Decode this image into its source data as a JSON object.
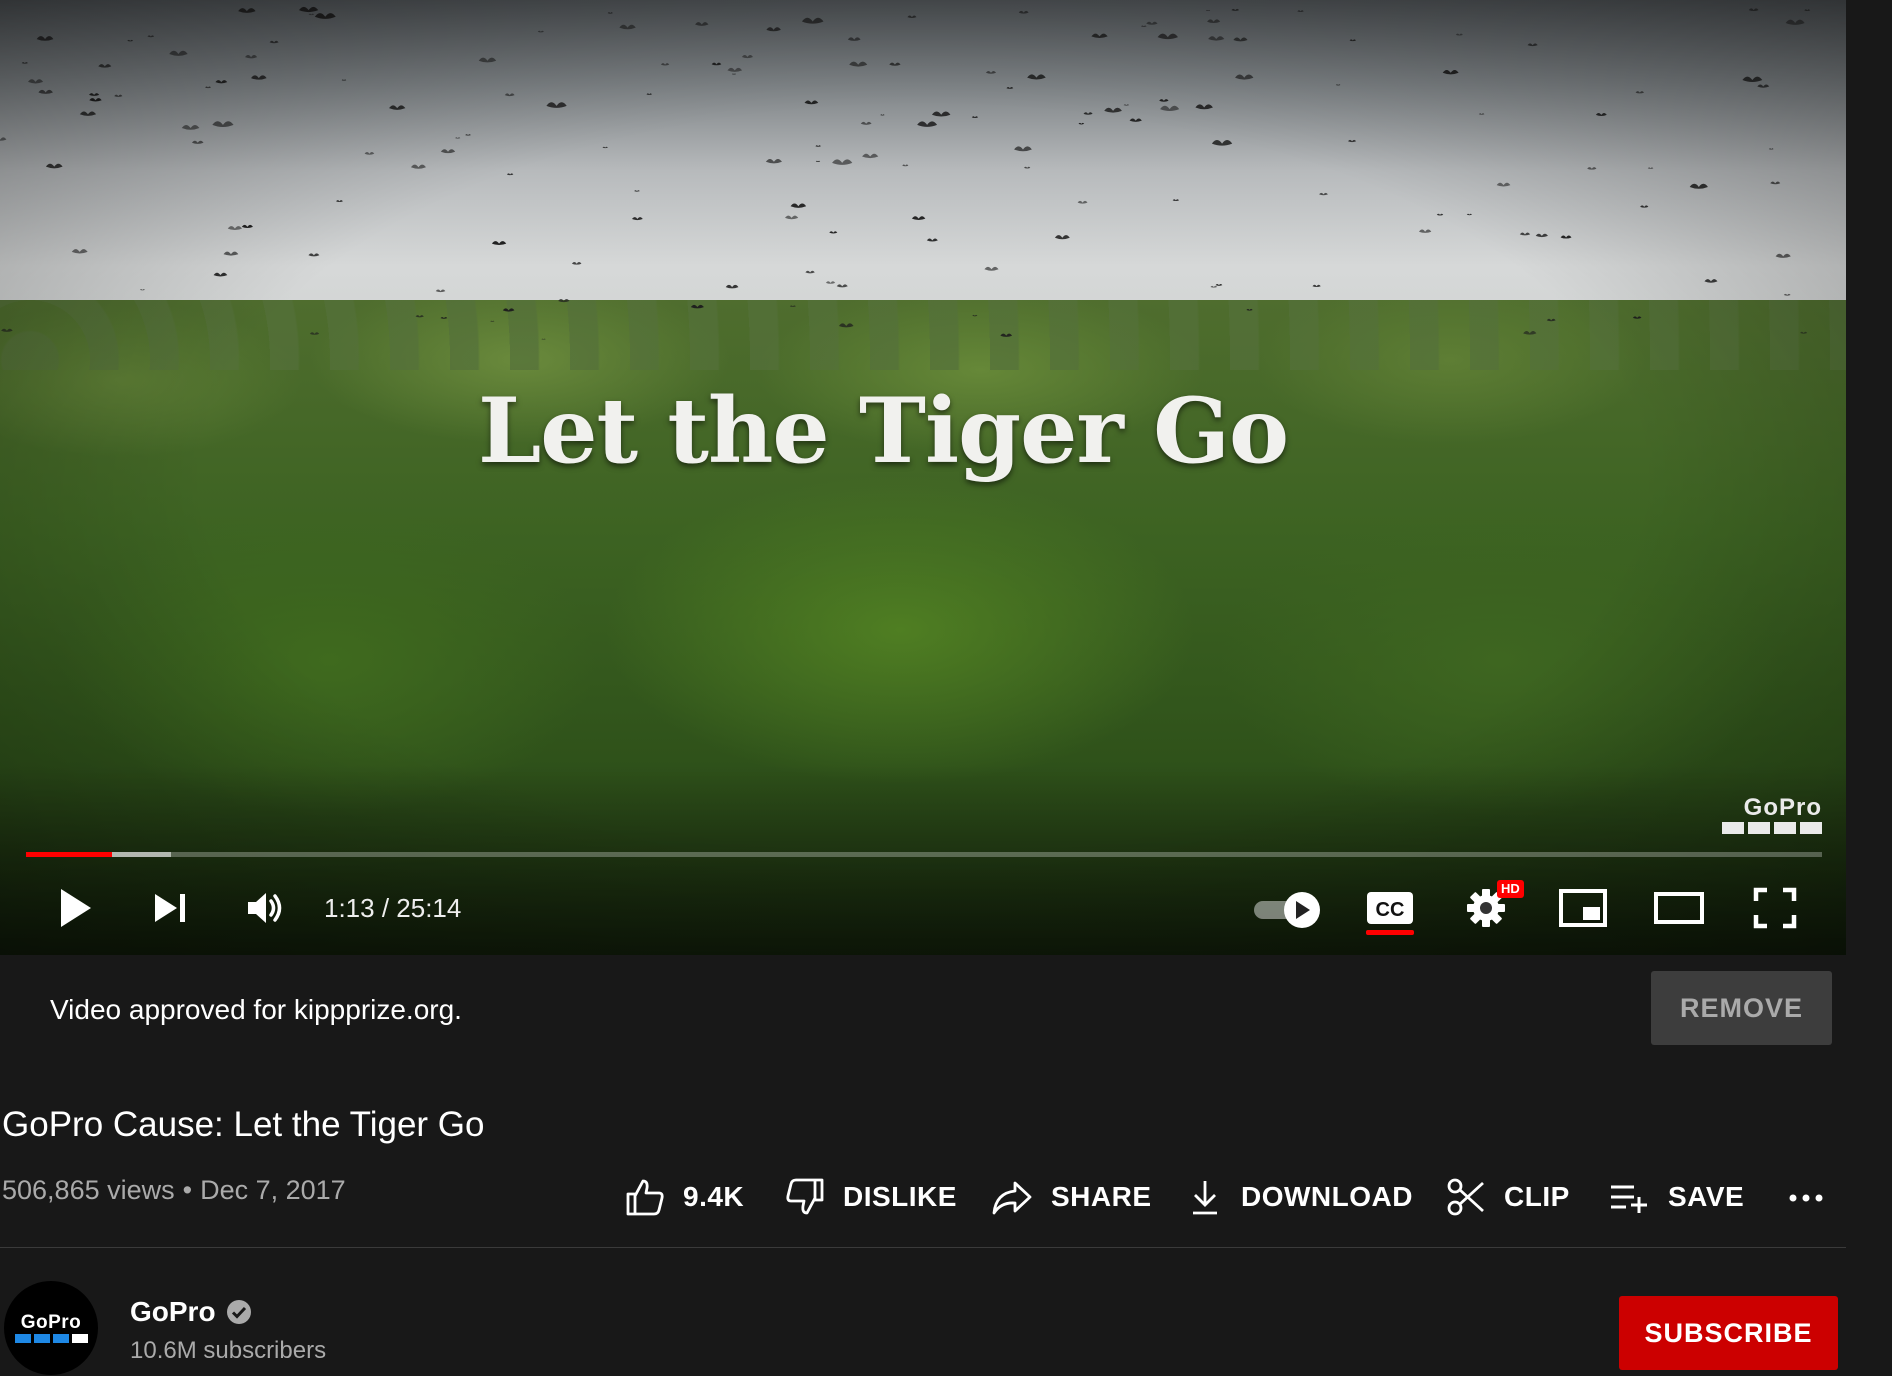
{
  "player": {
    "overlay_title": "Let the Tiger Go",
    "watermark": "GoPro",
    "progress": {
      "played_fraction": 0.048,
      "buffered_fraction": 0.081
    },
    "time_current": "1:13",
    "time_separator": " / ",
    "time_total": "25:14",
    "hd_badge": "HD",
    "controls": [
      "play-icon",
      "next-icon",
      "volume-icon",
      "autoplay-toggle",
      "cc-icon",
      "settings-icon",
      "miniplayer-icon",
      "theater-icon",
      "fullscreen-icon"
    ],
    "played_color": "#ff0000"
  },
  "notice": {
    "text": "Video approved for kippprize.org.",
    "remove_label": "REMOVE"
  },
  "video": {
    "title": "GoPro Cause: Let the Tiger Go",
    "views": "506,865 views",
    "separator": "•",
    "date": "Dec 7, 2017"
  },
  "actions": {
    "like_label": "9.4K",
    "dislike_label": "DISLIKE",
    "share_label": "SHARE",
    "download_label": "DOWNLOAD",
    "clip_label": "CLIP",
    "save_label": "SAVE",
    "more_label": "..."
  },
  "channel": {
    "name": "GoPro",
    "avatar_text": "GoPro",
    "subscribers": "10.6M subscribers",
    "subscribe_label": "SUBSCRIBE",
    "subscribe_color": "#cc0000",
    "avatar_bar_colors": [
      "#1e88e5",
      "#1e88e5",
      "#1e88e5",
      "#ffffff"
    ]
  }
}
